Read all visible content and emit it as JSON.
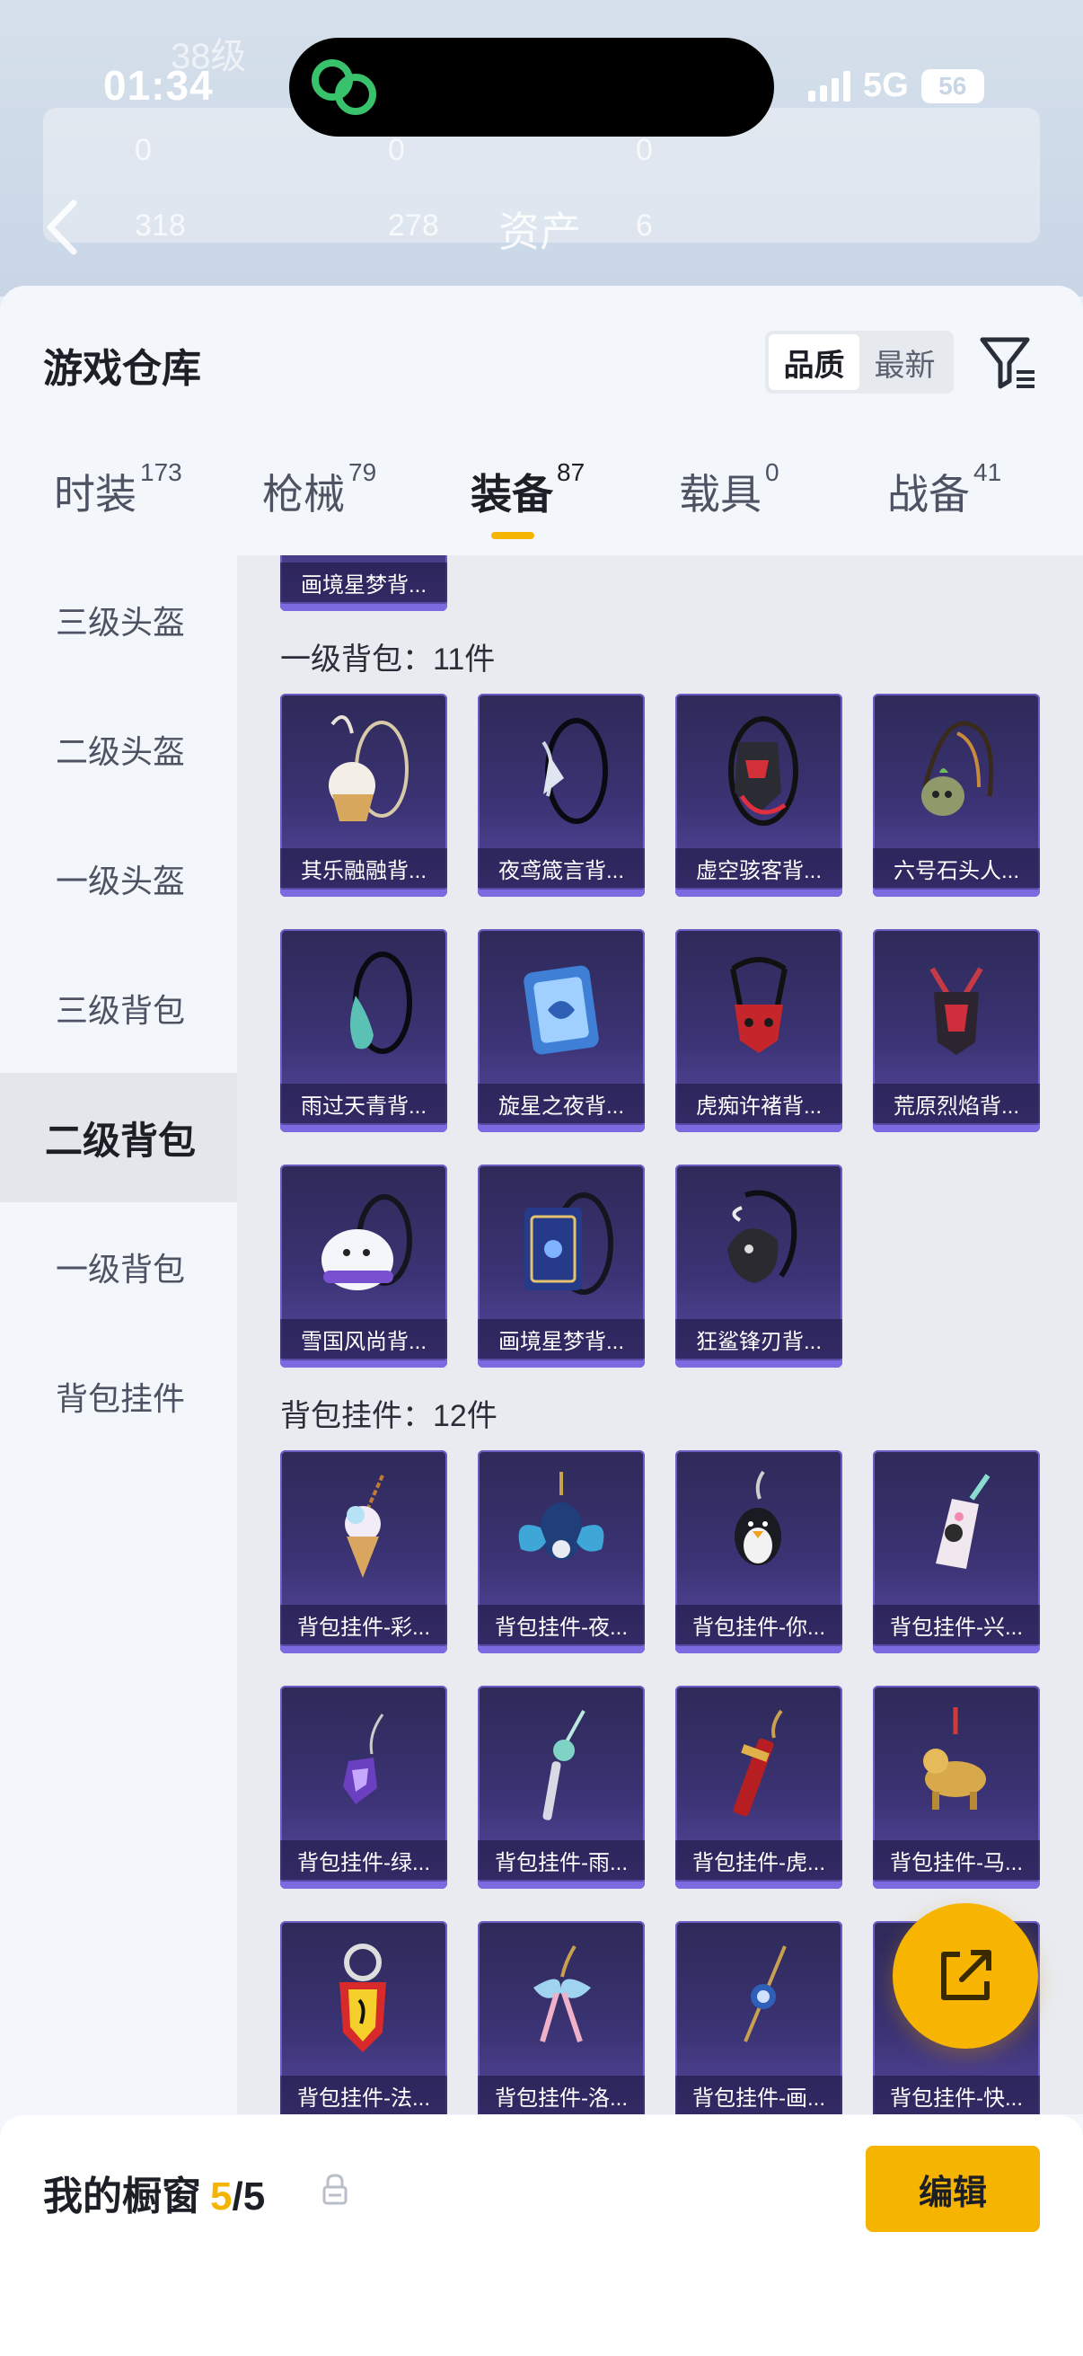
{
  "status_bar": {
    "time": "01:34",
    "network": "5G",
    "battery": "56"
  },
  "background": {
    "title": "资产",
    "level": "38级",
    "stats": [
      "0",
      "0",
      "0",
      "318",
      "278",
      "6"
    ]
  },
  "sheet": {
    "title": "游戏仓库",
    "sort_options": [
      {
        "label": "品质",
        "active": true
      },
      {
        "label": "最新",
        "active": false
      }
    ],
    "tabs": [
      {
        "label": "时装",
        "count": "173"
      },
      {
        "label": "枪械",
        "count": "79"
      },
      {
        "label": "装备",
        "count": "87"
      },
      {
        "label": "载具",
        "count": "0"
      },
      {
        "label": "战备",
        "count": "41"
      }
    ],
    "sidebar": [
      "三级头盔",
      "二级头盔",
      "一级头盔",
      "三级背包",
      "二级背包",
      "一级背包",
      "背包挂件"
    ],
    "active_sidebar_index": 4
  },
  "sections": [
    {
      "title": "",
      "items": [
        "画境星梦背..."
      ]
    },
    {
      "title": "一级背包：11件",
      "items": [
        "其乐融融背...",
        "夜鸢箴言背...",
        "虚空骇客背...",
        "六号石头人...",
        "雨过天青背...",
        "旋星之夜背...",
        "虎痴许褚背...",
        "荒原烈焰背...",
        "雪国风尚背...",
        "画境星梦背...",
        "狂鲨锋刃背..."
      ]
    },
    {
      "title": "背包挂件：12件",
      "items": [
        "背包挂件-彩...",
        "背包挂件-夜...",
        "背包挂件-你...",
        "背包挂件-兴...",
        "背包挂件-绿...",
        "背包挂件-雨...",
        "背包挂件-虎...",
        "背包挂件-马...",
        "背包挂件-法...",
        "背包挂件-洛...",
        "背包挂件-画...",
        "背包挂件-快..."
      ]
    }
  ],
  "bottom_bar": {
    "label": "我的橱窗",
    "current": "5",
    "separator": "/",
    "total": "5",
    "edit_label": "编辑"
  },
  "colors": {
    "accent": "#f5b400",
    "card_top": "#2e2a58",
    "card_bottom": "#5a4aa5"
  }
}
